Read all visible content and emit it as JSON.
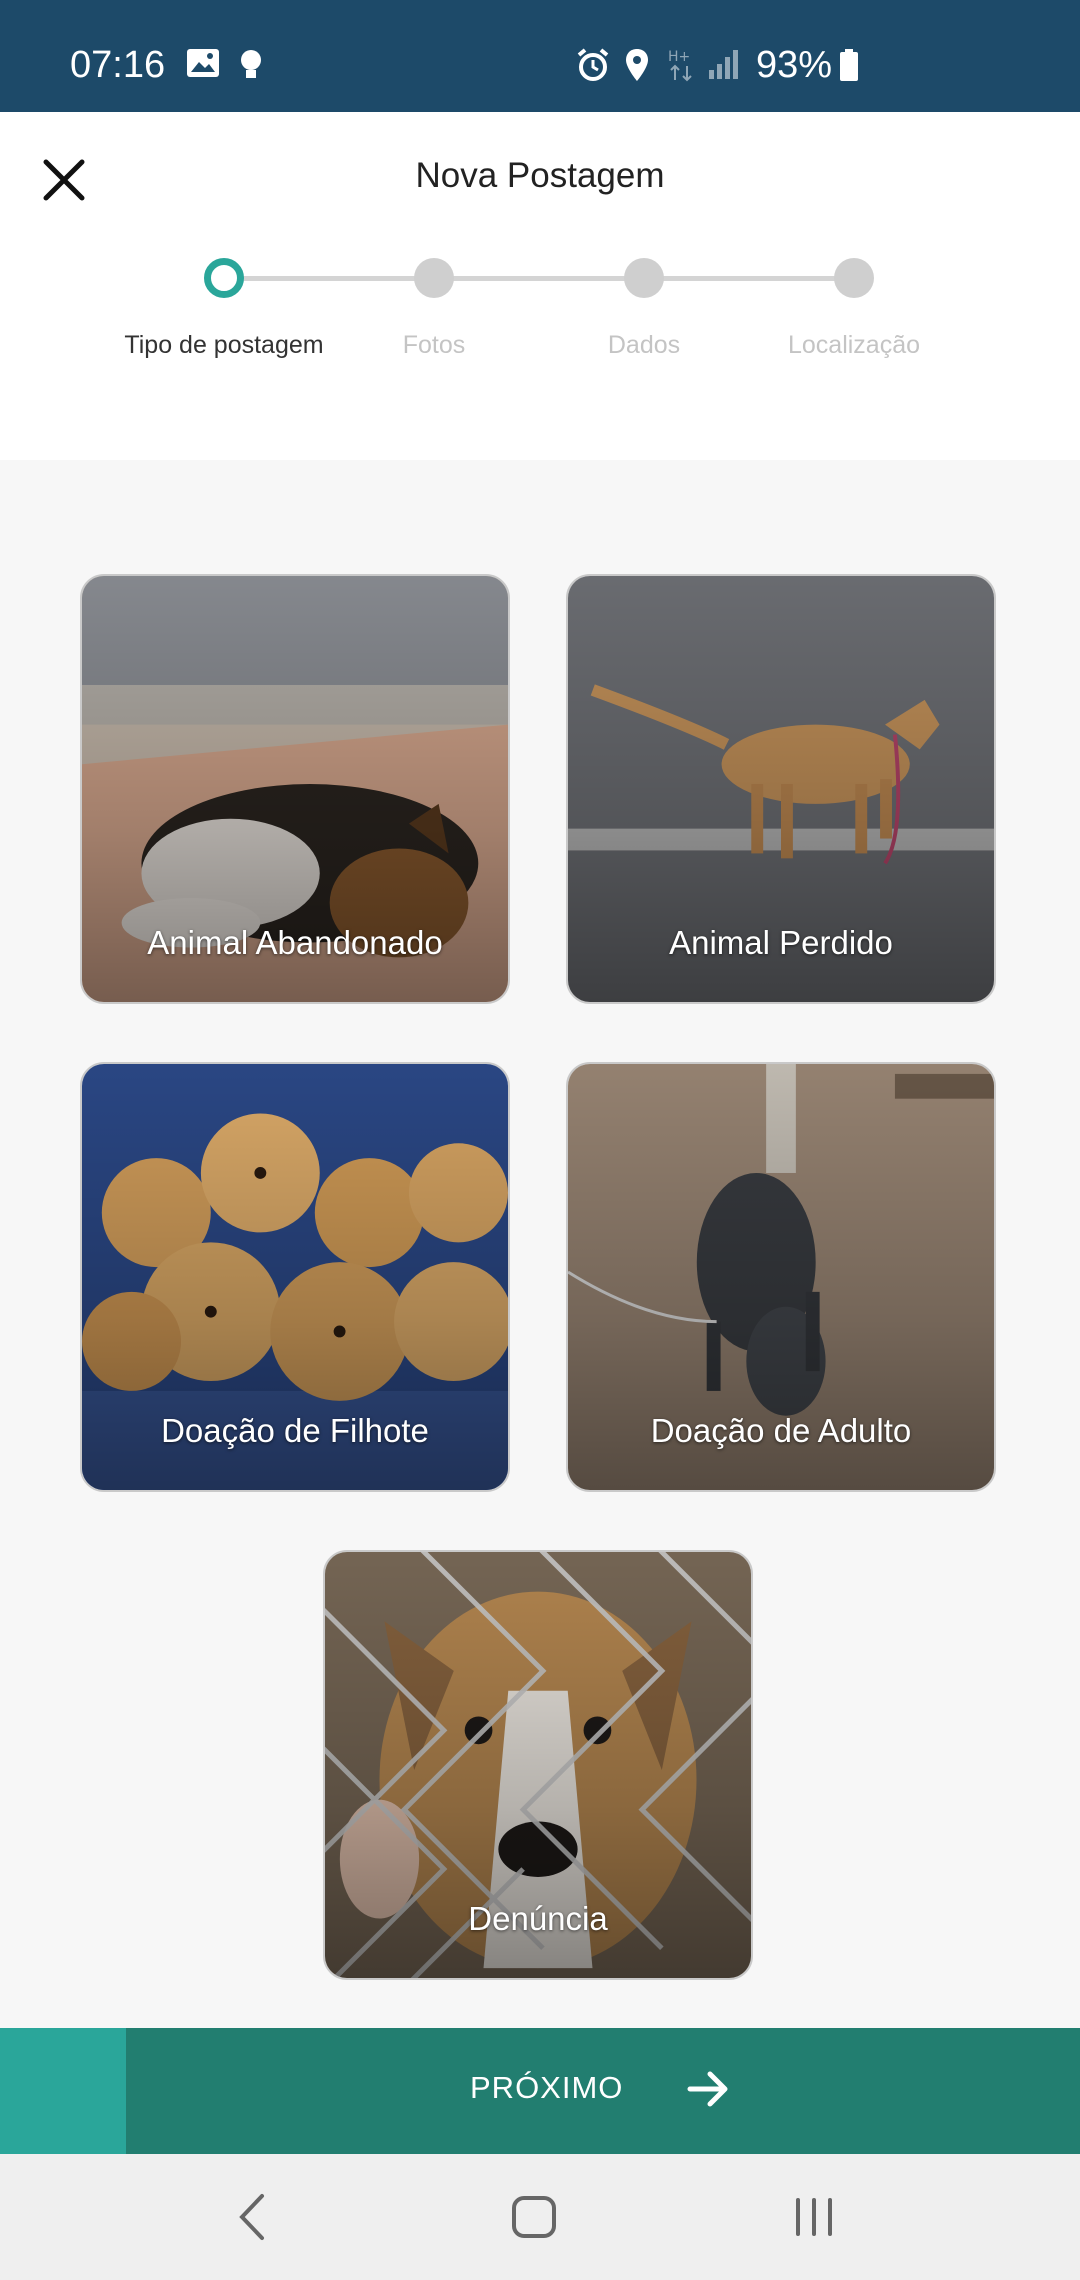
{
  "status_bar": {
    "time": "07:16",
    "battery": "93%",
    "icons": [
      "image-icon",
      "lightbulb-icon",
      "alarm-icon",
      "location-icon",
      "data-hplus-icon",
      "signal-icon",
      "battery-icon"
    ]
  },
  "header": {
    "title": "Nova Postagem",
    "close_icon": "close-icon"
  },
  "stepper": {
    "steps": [
      {
        "label": "Tipo de postagem",
        "active": true
      },
      {
        "label": "Fotos",
        "active": false
      },
      {
        "label": "Dados",
        "active": false
      },
      {
        "label": "Localização",
        "active": false
      }
    ]
  },
  "cards": [
    {
      "label": "Animal Abandonado"
    },
    {
      "label": "Animal Perdido"
    },
    {
      "label": "Doação de Filhote"
    },
    {
      "label": "Doação de Adulto"
    },
    {
      "label": "Denúncia"
    }
  ],
  "footer": {
    "next_label": "PRÓXIMO",
    "next_icon": "arrow-right-icon"
  },
  "navbar": {
    "icons": [
      "back-icon",
      "home-icon",
      "recents-icon"
    ]
  },
  "colors": {
    "status_bar": "#1d4a69",
    "accent": "#2aa69a",
    "button": "#227e70"
  }
}
